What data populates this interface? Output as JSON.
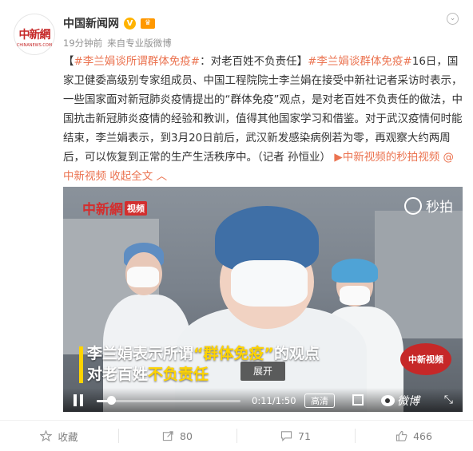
{
  "account": {
    "avatar_logo": "中新網",
    "avatar_sub": "CHINANEWS.COM",
    "name": "中国新闻网",
    "verified": "V",
    "vip": "♛"
  },
  "meta": {
    "time": "19分钟前",
    "source_prefix": "来自",
    "source": "专业版微博"
  },
  "post": {
    "bracket_open": "【",
    "topic1": "#李兰娟谈所谓群体免疫#",
    "title_tail": "：对老百姓不负责任】",
    "topic2": "#李兰娟谈群体免疫#",
    "body": "16日，国家卫健委高级别专家组成员、中国工程院院士李兰娟在接受中新社记者采访时表示，一些国家面对新冠肺炎疫情提出的“群体免疫”观点，是对老百姓不负责任的做法，中国抗击新冠肺炎疫情的经验和教训，值得其他国家学习和借鉴。对于武汉疫情何时能结束，李兰娟表示，到3月20日前后，武汉新发感染病例若为零，再观察大约两周后，可以恢复到正常的生产生活秩序中。（记者 孙恒业）",
    "video_link": "中新视频的秒拍视频",
    "mention": "@中新视频",
    "collapse": "收起全文",
    "collapse_icon": "︿"
  },
  "video": {
    "logo_tl": "中新網",
    "logo_tl_box": "视频",
    "miaopai": "秒拍",
    "caption_line1_pre": "李兰娟表示所谓",
    "caption_line1_hl": "“群体免疫”",
    "caption_line1_post": "的观点",
    "caption_line2_pre": "对老百姓",
    "caption_line2_hl": "不负责任",
    "expand": "展开",
    "logo_br": "中新视频",
    "time": "0:11/1:50",
    "quality": "高清",
    "weibo": "微博",
    "progress": 0.1
  },
  "actions": [
    {
      "icon": "star-icon",
      "label": "收藏"
    },
    {
      "icon": "share-icon",
      "label": "80"
    },
    {
      "icon": "comment-icon",
      "label": "71"
    },
    {
      "icon": "like-icon",
      "label": "466"
    }
  ],
  "colors": {
    "link": "#eb7350",
    "caption_highlight": "#ffd400",
    "brand_red": "#d32f2f"
  }
}
